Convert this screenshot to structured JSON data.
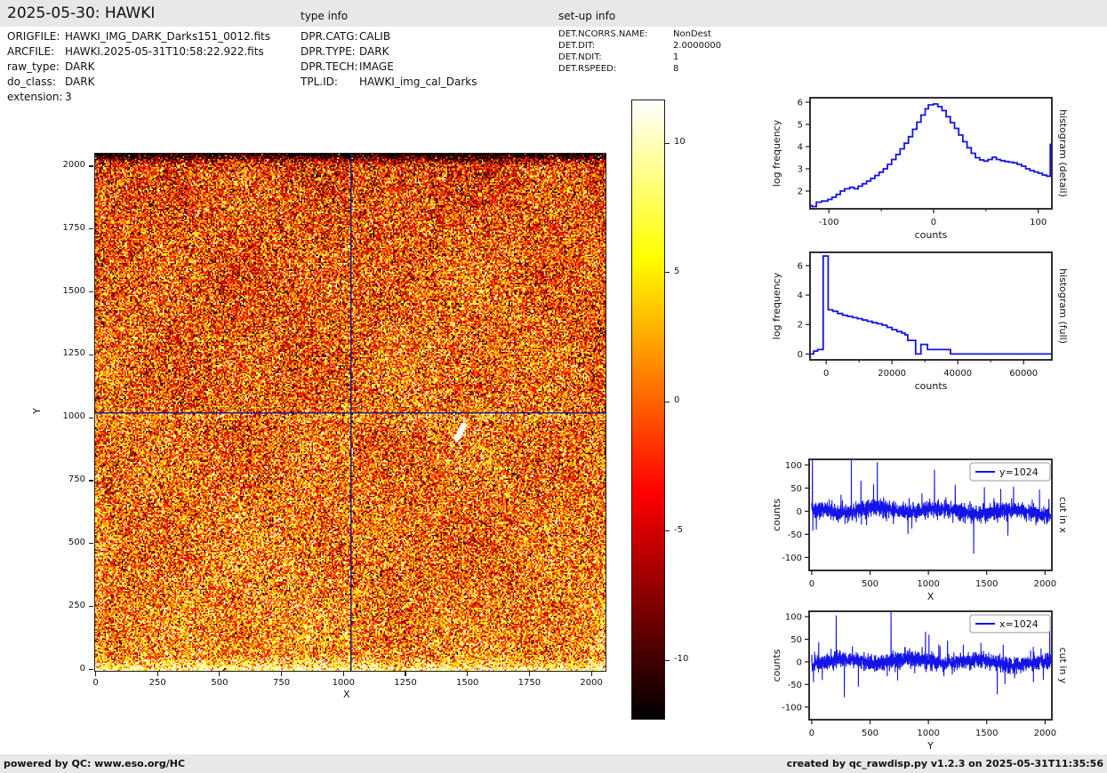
{
  "header": {
    "title": "2025-05-30: HAWKI",
    "type_info_label": "type info",
    "setup_info_label": "set-up info"
  },
  "file_info": {
    "rows": [
      {
        "label": "ORIGFILE:",
        "value": "HAWKI_IMG_DARK_Darks151_0012.fits"
      },
      {
        "label": "ARCFILE:",
        "value": "HAWKI.2025-05-31T10:58:22.922.fits"
      },
      {
        "label": "raw_type:",
        "value": "DARK"
      },
      {
        "label": "do_class:",
        "value": "DARK"
      },
      {
        "label": "extension:",
        "value": "3"
      }
    ]
  },
  "type_info": {
    "rows": [
      {
        "label": "DPR.CATG:",
        "value": "CALIB"
      },
      {
        "label": "DPR.TYPE:",
        "value": "DARK"
      },
      {
        "label": "DPR.TECH:",
        "value": "IMAGE"
      },
      {
        "label": "TPL.ID:",
        "value": "HAWKI_img_cal_Darks"
      }
    ]
  },
  "setup_info": {
    "rows": [
      {
        "label": "DET.NCORRS.NAME:",
        "value": "NonDest"
      },
      {
        "label": "DET.DIT:",
        "value": "2.0000000"
      },
      {
        "label": "DET.NDIT:",
        "value": "1"
      },
      {
        "label": "DET.RSPEED:",
        "value": "8"
      }
    ]
  },
  "footer": {
    "left": "powered by QC: www.eso.org/HC",
    "right": "created by qc_rawdisp.py v1.2.3 on 2025-05-31T11:35:56"
  },
  "colors": {
    "line_blue": "#1414e6",
    "crosshair_navy": "#1b1b8e",
    "spine": "#1a1a1a",
    "bar_bg": "#e8e8e8"
  },
  "chart_data": [
    {
      "id": "main-image",
      "type": "heatmap",
      "xlabel": "X",
      "ylabel": "Y",
      "xlim": [
        0,
        2048
      ],
      "ylim": [
        0,
        2048
      ],
      "x_ticks": [
        0,
        250,
        500,
        750,
        1000,
        1250,
        1500,
        1750,
        2000
      ],
      "y_ticks": [
        0,
        250,
        500,
        750,
        1000,
        1250,
        1500,
        1750,
        2000
      ],
      "colormap": "hot",
      "vmin": -12.3,
      "vmax": 11.7,
      "crosshair": {
        "x": 1024,
        "y": 1024
      },
      "noise_seed": 1337,
      "noise_sigma": 5.6,
      "outlier_prob": 0.04,
      "artifact_streak": {
        "x": 1463,
        "y": 950
      }
    },
    {
      "id": "colorbar",
      "type": "colorbar",
      "ticks": [
        10,
        5,
        0,
        -5,
        -10
      ],
      "vmin": -12.3,
      "vmax": 11.7,
      "colormap": "hot"
    },
    {
      "id": "hist-detail",
      "type": "step",
      "xlabel": "counts",
      "ylabel": "log frequency",
      "right_label": "histogram (detail)",
      "xlim": [
        -118,
        113
      ],
      "ylim": [
        1.2,
        6.2
      ],
      "x_ticks": [
        -100,
        0,
        100
      ],
      "x_minor": [
        -50,
        50
      ],
      "y_ticks": [
        2,
        3,
        4,
        5,
        6
      ],
      "steps": [
        [
          -118,
          1.35
        ],
        [
          -116,
          1.3
        ],
        [
          -112,
          1.5
        ],
        [
          -107,
          1.55
        ],
        [
          -101,
          1.62
        ],
        [
          -97,
          1.72
        ],
        [
          -93,
          1.85
        ],
        [
          -89,
          2.0
        ],
        [
          -85,
          2.1
        ],
        [
          -80,
          2.17
        ],
        [
          -76,
          2.1
        ],
        [
          -72,
          2.22
        ],
        [
          -68,
          2.33
        ],
        [
          -64,
          2.45
        ],
        [
          -60,
          2.57
        ],
        [
          -56,
          2.7
        ],
        [
          -52,
          2.85
        ],
        [
          -48,
          3.0
        ],
        [
          -44,
          3.2
        ],
        [
          -40,
          3.42
        ],
        [
          -36,
          3.65
        ],
        [
          -32,
          3.9
        ],
        [
          -28,
          4.15
        ],
        [
          -24,
          4.45
        ],
        [
          -20,
          4.78
        ],
        [
          -16,
          5.1
        ],
        [
          -12,
          5.42
        ],
        [
          -8,
          5.7
        ],
        [
          -5,
          5.88
        ],
        [
          0,
          5.92
        ],
        [
          4,
          5.8
        ],
        [
          8,
          5.62
        ],
        [
          12,
          5.35
        ],
        [
          16,
          5.08
        ],
        [
          20,
          4.82
        ],
        [
          24,
          4.52
        ],
        [
          28,
          4.22
        ],
        [
          32,
          3.95
        ],
        [
          36,
          3.7
        ],
        [
          40,
          3.5
        ],
        [
          44,
          3.4
        ],
        [
          48,
          3.35
        ],
        [
          52,
          3.42
        ],
        [
          56,
          3.52
        ],
        [
          60,
          3.42
        ],
        [
          64,
          3.37
        ],
        [
          68,
          3.33
        ],
        [
          72,
          3.3
        ],
        [
          76,
          3.27
        ],
        [
          80,
          3.2
        ],
        [
          84,
          3.12
        ],
        [
          88,
          3.0
        ],
        [
          92,
          2.92
        ],
        [
          96,
          2.86
        ],
        [
          100,
          2.8
        ],
        [
          104,
          2.72
        ],
        [
          108,
          2.67
        ],
        [
          111,
          2.67
        ],
        [
          111.5,
          4.1
        ],
        [
          113,
          4.1
        ]
      ]
    },
    {
      "id": "hist-full",
      "type": "step",
      "xlabel": "counts",
      "ylabel": "log frequency",
      "right_label": "histogram (full)",
      "xlim": [
        -4900,
        68600
      ],
      "ylim": [
        -0.4,
        6.9
      ],
      "x_ticks": [
        0,
        20000,
        40000,
        60000
      ],
      "x_minor": [
        10000,
        30000,
        50000
      ],
      "y_ticks": [
        0,
        2,
        4,
        6
      ],
      "steps": [
        [
          -4800,
          0
        ],
        [
          -3800,
          0.2
        ],
        [
          -2600,
          0.3
        ],
        [
          -900,
          6.65
        ],
        [
          600,
          3.0
        ],
        [
          2000,
          2.9
        ],
        [
          3500,
          2.75
        ],
        [
          5000,
          2.62
        ],
        [
          6500,
          2.55
        ],
        [
          8000,
          2.47
        ],
        [
          9500,
          2.4
        ],
        [
          11000,
          2.3
        ],
        [
          12500,
          2.22
        ],
        [
          14000,
          2.12
        ],
        [
          15500,
          2.05
        ],
        [
          17000,
          1.95
        ],
        [
          18500,
          1.8
        ],
        [
          20000,
          1.65
        ],
        [
          21500,
          1.52
        ],
        [
          23000,
          1.42
        ],
        [
          24000,
          1.3
        ],
        [
          24800,
          0.92
        ],
        [
          27200,
          0.0
        ],
        [
          28800,
          0.65
        ],
        [
          30800,
          0.3
        ],
        [
          37800,
          0.0
        ],
        [
          68400,
          0.0
        ]
      ]
    },
    {
      "id": "cut-x",
      "type": "noise-line",
      "legend": "y=1024",
      "xlabel": "X",
      "ylabel": "counts",
      "right_label": "cut in x",
      "xlim": [
        -22,
        2058
      ],
      "ylim": [
        -128,
        112
      ],
      "x_ticks": [
        0,
        500,
        1000,
        1500,
        2000
      ],
      "y_ticks": [
        -100,
        -50,
        0,
        50,
        100
      ],
      "n_points": 2048,
      "noise_seed": 77,
      "noise_sigma": 9,
      "spikes": [
        [
          6,
          118
        ],
        [
          10,
          -42
        ],
        [
          40,
          -40
        ],
        [
          150,
          25
        ],
        [
          340,
          113
        ],
        [
          422,
          66
        ],
        [
          470,
          -30
        ],
        [
          530,
          58
        ],
        [
          562,
          106
        ],
        [
          700,
          -28
        ],
        [
          1052,
          90
        ],
        [
          1150,
          30
        ],
        [
          1230,
          57
        ],
        [
          1388,
          -92
        ],
        [
          1480,
          52
        ],
        [
          1620,
          48
        ],
        [
          1730,
          53
        ],
        [
          1952,
          47
        ]
      ]
    },
    {
      "id": "cut-y",
      "type": "noise-line",
      "legend": "x=1024",
      "xlabel": "Y",
      "ylabel": "counts",
      "right_label": "cut in y",
      "xlim": [
        -22,
        2058
      ],
      "ylim": [
        -128,
        112
      ],
      "x_ticks": [
        0,
        500,
        1000,
        1500,
        2000
      ],
      "y_ticks": [
        -100,
        -50,
        0,
        50,
        100
      ],
      "n_points": 2048,
      "noise_seed": 99,
      "noise_sigma": 9,
      "spikes": [
        [
          15,
          -45
        ],
        [
          60,
          44
        ],
        [
          210,
          103
        ],
        [
          280,
          -78
        ],
        [
          400,
          -55
        ],
        [
          680,
          113
        ],
        [
          975,
          67
        ],
        [
          1005,
          60
        ],
        [
          1100,
          35
        ],
        [
          1300,
          38
        ],
        [
          1450,
          42
        ],
        [
          1590,
          -72
        ],
        [
          1900,
          -45
        ],
        [
          2040,
          76
        ]
      ]
    }
  ]
}
